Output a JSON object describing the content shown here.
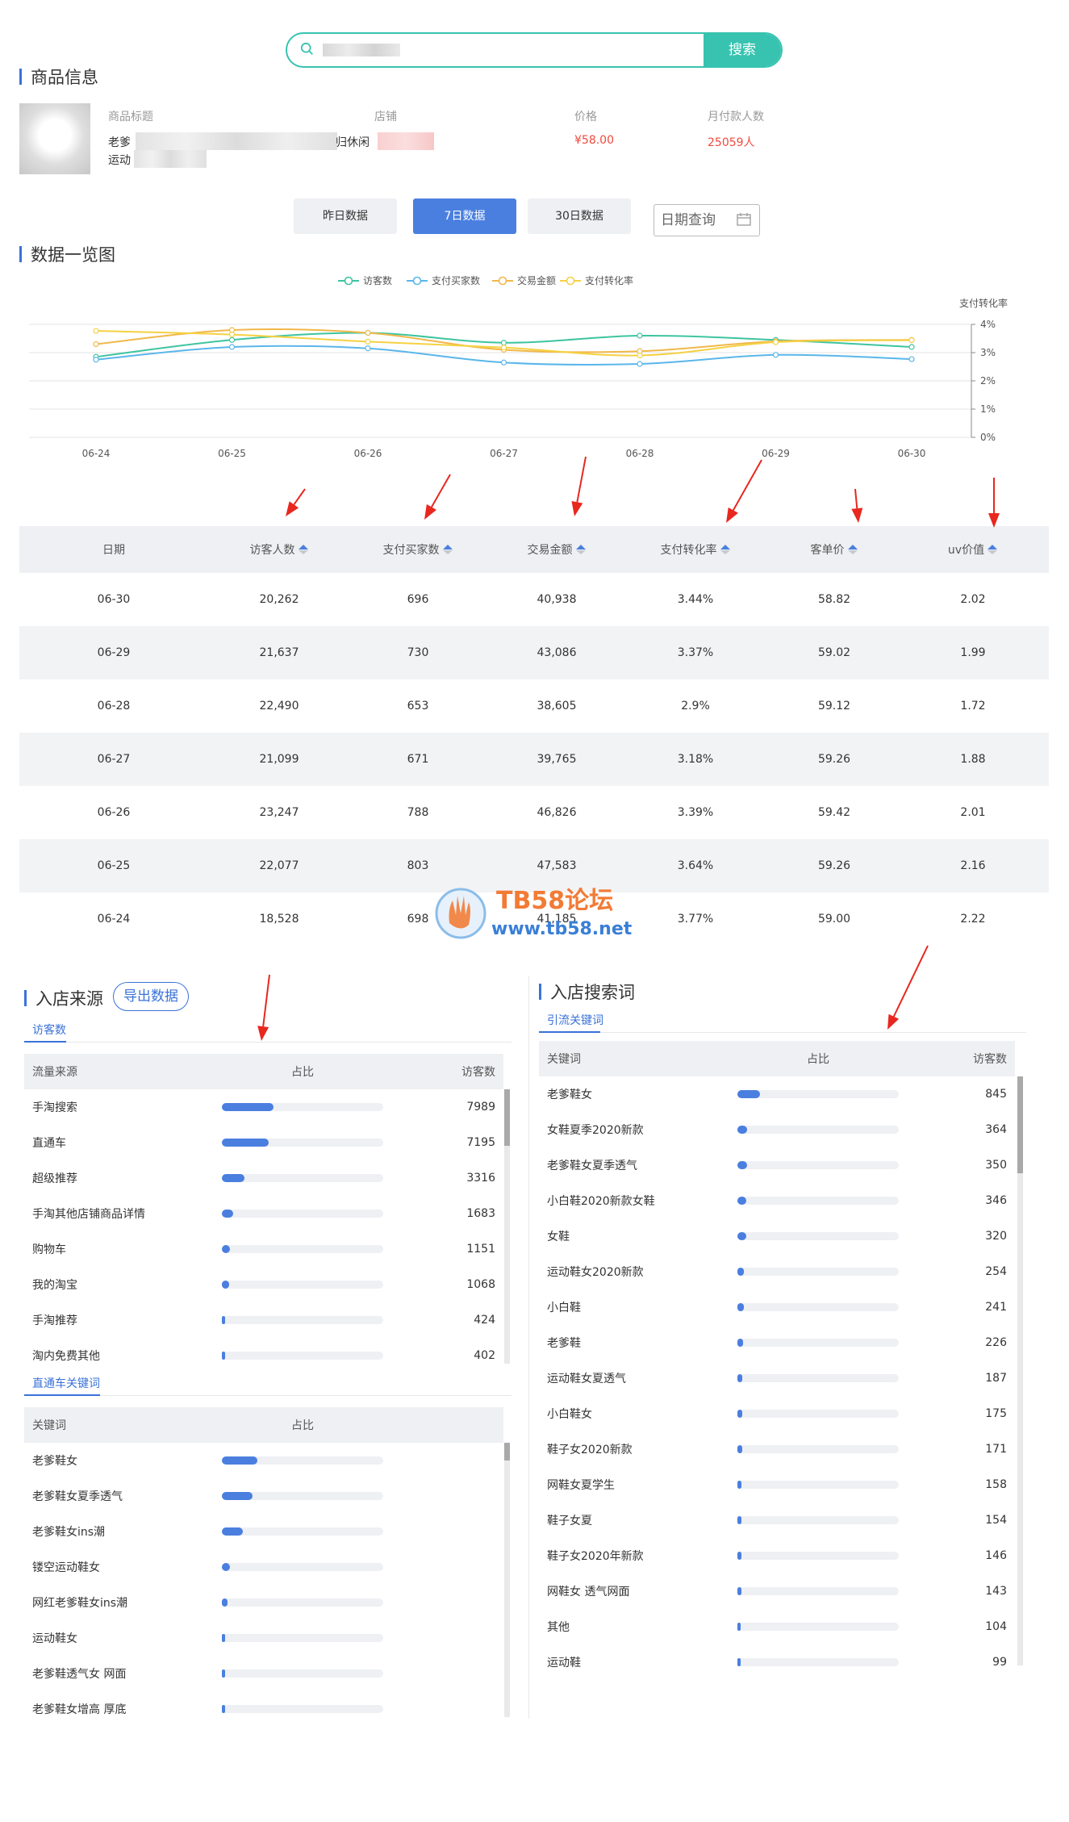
{
  "search": {
    "button_label": "搜索"
  },
  "product_section": {
    "title": "商品信息",
    "col_labels": [
      "商品标题",
      "店铺",
      "价格",
      "月付款人数"
    ],
    "title_line1": "老爹",
    "title_line2": "运动",
    "shop_visible": "归休闲",
    "price": "¥58.00",
    "monthly_buyers": "25059人"
  },
  "tabs": [
    {
      "label": "昨日数据",
      "active": false
    },
    {
      "label": "7日数据",
      "active": true
    },
    {
      "label": "30日数据",
      "active": false
    }
  ],
  "date_query": {
    "label": "日期查询"
  },
  "overview": {
    "title": "数据一览图"
  },
  "chart_data": {
    "type": "line",
    "legend": [
      "访客数",
      "支付买家数",
      "交易金额",
      "支付转化率"
    ],
    "legend_position": "top-center",
    "right_axis_label": "支付转化率",
    "y_ticks": [
      "4%",
      "3%",
      "2%",
      "1%",
      "0%"
    ],
    "x": [
      "06-24",
      "06-25",
      "06-26",
      "06-27",
      "06-28",
      "06-29",
      "06-30"
    ],
    "ylim": [
      0,
      4
    ],
    "colors": [
      "#3ec4a0",
      "#5ab6ea",
      "#f0b84a",
      "#f5d142"
    ],
    "series": [
      {
        "name": "访客数",
        "values": [
          2.85,
          3.45,
          3.7,
          3.35,
          3.6,
          3.45,
          3.2
        ]
      },
      {
        "name": "支付买家数",
        "values": [
          2.75,
          3.2,
          3.15,
          2.65,
          2.6,
          2.92,
          2.77
        ]
      },
      {
        "name": "交易金额",
        "values": [
          3.3,
          3.8,
          3.7,
          3.1,
          3.05,
          3.4,
          3.45
        ]
      },
      {
        "name": "支付转化率",
        "values": [
          3.77,
          3.64,
          3.39,
          3.18,
          2.9,
          3.37,
          3.44
        ]
      }
    ]
  },
  "table": {
    "headers": [
      "日期",
      "访客人数",
      "支付买家数",
      "交易金额",
      "支付转化率",
      "客单价",
      "uv价值"
    ],
    "rows": [
      [
        "06-30",
        "20,262",
        "696",
        "40,938",
        "3.44%",
        "58.82",
        "2.02"
      ],
      [
        "06-29",
        "21,637",
        "730",
        "43,086",
        "3.37%",
        "59.02",
        "1.99"
      ],
      [
        "06-28",
        "22,490",
        "653",
        "38,605",
        "2.9%",
        "59.12",
        "1.72"
      ],
      [
        "06-27",
        "21,099",
        "671",
        "39,765",
        "3.18%",
        "59.26",
        "1.88"
      ],
      [
        "06-26",
        "23,247",
        "788",
        "46,826",
        "3.39%",
        "59.42",
        "2.01"
      ],
      [
        "06-25",
        "22,077",
        "803",
        "47,583",
        "3.64%",
        "59.26",
        "2.16"
      ],
      [
        "06-24",
        "18,528",
        "698",
        "41,185",
        "3.77%",
        "59.00",
        "2.22"
      ]
    ]
  },
  "watermark": {
    "line1": "TB58论坛",
    "line2": "www.tb58.net"
  },
  "store_source": {
    "title": "入店来源",
    "export_label": "导出数据",
    "tab_label": "访客数",
    "headers": [
      "流量来源",
      "占比",
      "访客数"
    ],
    "rows": [
      {
        "name": "手淘搜索",
        "ratio": 0.32,
        "value": "7989"
      },
      {
        "name": "直通车",
        "ratio": 0.29,
        "value": "7195"
      },
      {
        "name": "超级推荐",
        "ratio": 0.14,
        "value": "3316"
      },
      {
        "name": "手淘其他店铺商品详情",
        "ratio": 0.07,
        "value": "1683"
      },
      {
        "name": "购物车",
        "ratio": 0.05,
        "value": "1151"
      },
      {
        "name": "我的淘宝",
        "ratio": 0.045,
        "value": "1068"
      },
      {
        "name": "手淘推荐",
        "ratio": 0.018,
        "value": "424"
      },
      {
        "name": "淘内免费其他",
        "ratio": 0.016,
        "value": "402"
      }
    ]
  },
  "ztc_keywords": {
    "tab_label": "直通车关键词",
    "headers": [
      "关键词",
      "占比"
    ],
    "rows": [
      {
        "name": "老爹鞋女",
        "ratio": 0.22
      },
      {
        "name": "老爹鞋女夏季透气",
        "ratio": 0.19
      },
      {
        "name": "老爹鞋女ins潮",
        "ratio": 0.13
      },
      {
        "name": "镂空运动鞋女",
        "ratio": 0.05
      },
      {
        "name": "网红老爹鞋女ins潮",
        "ratio": 0.035
      },
      {
        "name": "运动鞋女",
        "ratio": 0.02
      },
      {
        "name": "老爹鞋透气女 网面",
        "ratio": 0.02
      },
      {
        "name": "老爹鞋女增高 厚底",
        "ratio": 0.015
      }
    ]
  },
  "search_keywords": {
    "title": "入店搜索词",
    "tab_label": "引流关键词",
    "headers": [
      "关键词",
      "占比",
      "访客数"
    ],
    "rows": [
      {
        "name": "老爹鞋女",
        "ratio": 0.14,
        "value": "845"
      },
      {
        "name": "女鞋夏季2020新款",
        "ratio": 0.06,
        "value": "364"
      },
      {
        "name": "老爹鞋女夏季透气",
        "ratio": 0.058,
        "value": "350"
      },
      {
        "name": "小白鞋2020新款女鞋",
        "ratio": 0.057,
        "value": "346"
      },
      {
        "name": "女鞋",
        "ratio": 0.053,
        "value": "320"
      },
      {
        "name": "运动鞋女2020新款",
        "ratio": 0.042,
        "value": "254"
      },
      {
        "name": "小白鞋",
        "ratio": 0.04,
        "value": "241"
      },
      {
        "name": "老爹鞋",
        "ratio": 0.037,
        "value": "226"
      },
      {
        "name": "运动鞋女夏透气",
        "ratio": 0.031,
        "value": "187"
      },
      {
        "name": "小白鞋女",
        "ratio": 0.029,
        "value": "175"
      },
      {
        "name": "鞋子女2020新款",
        "ratio": 0.028,
        "value": "171"
      },
      {
        "name": "网鞋女夏学生",
        "ratio": 0.026,
        "value": "158"
      },
      {
        "name": "鞋子女夏",
        "ratio": 0.025,
        "value": "154"
      },
      {
        "name": "鞋子女2020年新款",
        "ratio": 0.024,
        "value": "146"
      },
      {
        "name": "网鞋女 透气网面",
        "ratio": 0.023,
        "value": "143"
      },
      {
        "name": "其他",
        "ratio": 0.017,
        "value": "104"
      },
      {
        "name": "运动鞋",
        "ratio": 0.016,
        "value": "99"
      }
    ]
  }
}
